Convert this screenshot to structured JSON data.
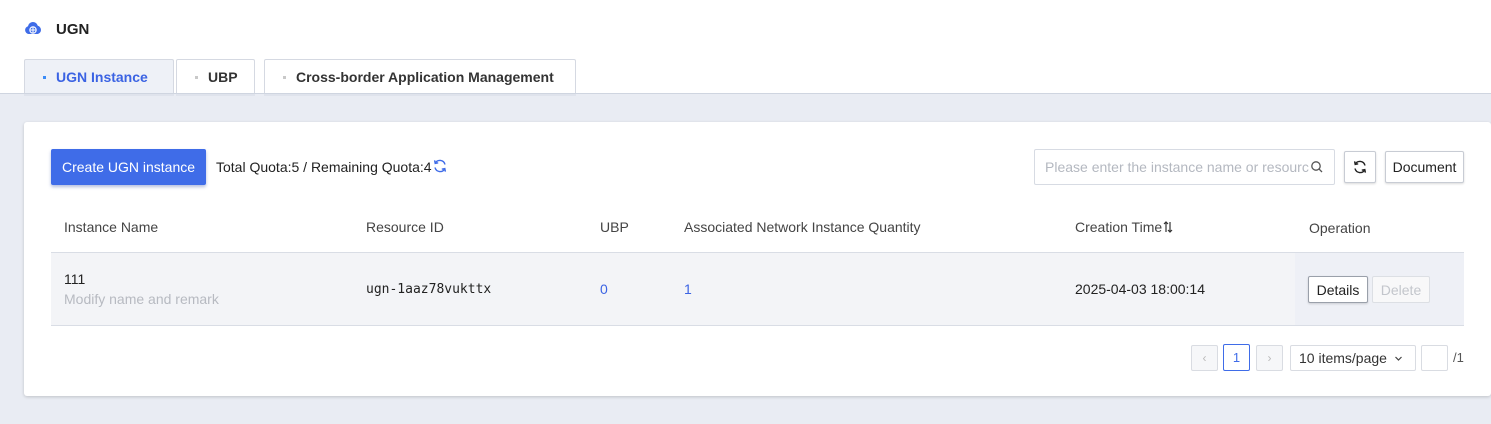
{
  "app": {
    "title": "UGN"
  },
  "tabs": [
    {
      "label": "UGN Instance",
      "active": true
    },
    {
      "label": "UBP",
      "active": false
    },
    {
      "label": "Cross-border Application Management",
      "active": false
    }
  ],
  "toolbar": {
    "create_label": "Create UGN instance",
    "quota_text": "Total Quota:5 / Remaining Quota:4",
    "search_placeholder": "Please enter the instance name or resource ID",
    "document_label": "Document"
  },
  "table": {
    "columns": [
      "Instance Name",
      "Resource ID",
      "UBP",
      "Associated Network Instance Quantity",
      "Creation Time",
      "Operation"
    ],
    "rows": [
      {
        "name": "111",
        "remark": "Modify name and remark",
        "resource_id": "ugn-1aaz78vukttx",
        "ubp": "0",
        "associated": "1",
        "creation_time": "2025-04-03 18:00:14",
        "details_label": "Details",
        "delete_label": "Delete"
      }
    ]
  },
  "pagination": {
    "prev": "‹",
    "next": "›",
    "current_page": "1",
    "page_size": "10 items/page",
    "total_pages": "/1"
  },
  "colors": {
    "accent": "#3f6ce8",
    "link": "#3b63e3",
    "background": "#e9ecf3"
  }
}
